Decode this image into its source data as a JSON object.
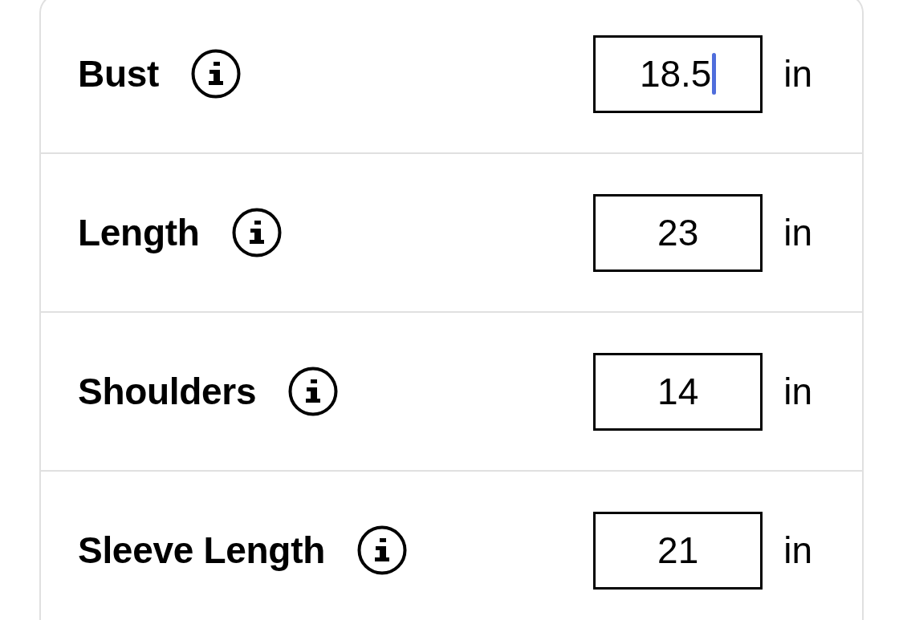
{
  "measurements": [
    {
      "label": "Bust",
      "value": "18.5",
      "unit": "in",
      "focused": true
    },
    {
      "label": "Length",
      "value": "23",
      "unit": "in",
      "focused": false
    },
    {
      "label": "Shoulders",
      "value": "14",
      "unit": "in",
      "focused": false
    },
    {
      "label": "Sleeve Length",
      "value": "21",
      "unit": "in",
      "focused": false
    }
  ]
}
